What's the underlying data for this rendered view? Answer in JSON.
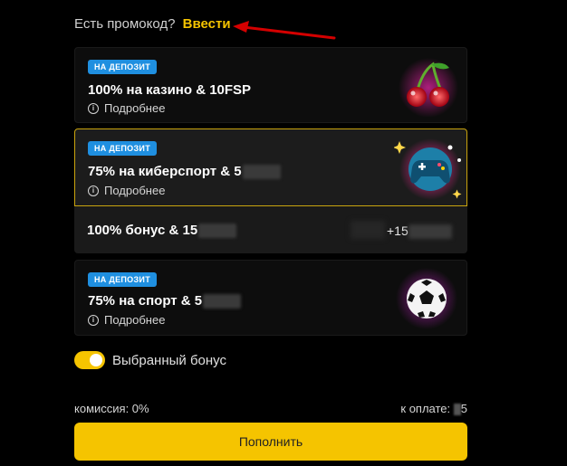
{
  "promo": {
    "question": "Есть промокод?",
    "link": "Ввести"
  },
  "cards": [
    {
      "badge": "НА ДЕПОЗИТ",
      "title": "100% на казино & 10FSP",
      "more": "Подробнее",
      "art": "cherries-icon"
    },
    {
      "badge": "НА ДЕПОЗИТ",
      "title": "75% на киберспорт & 5",
      "more": "Подробнее",
      "art": "gamepad-icon",
      "selected": true
    },
    {
      "badge": "НА ДЕПОЗИТ",
      "title": "75% на спорт & 5",
      "more": "Подробнее",
      "art": "soccer-ball-icon"
    }
  ],
  "bonus_row": {
    "title": "100% бонус & 15",
    "amount": "+15"
  },
  "toggle": {
    "label": "Выбранный бонус",
    "on": true
  },
  "footer": {
    "fee": "комиссия: 0%",
    "pay_label": "к оплате:",
    "pay_value": "5"
  },
  "submit": {
    "label": "Пополнить"
  },
  "colors": {
    "accent": "#f5c400",
    "badge": "#1f8fe0",
    "annotation": "#d40000"
  }
}
